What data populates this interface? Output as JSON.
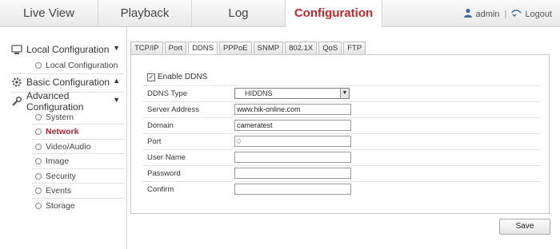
{
  "nav": {
    "tabs": [
      "Live View",
      "Playback",
      "Log",
      "Configuration"
    ],
    "active": "Configuration",
    "user": "admin",
    "logout": "Logout"
  },
  "sidebar": {
    "local": {
      "title": "Local Configuration",
      "items": [
        "Local Configuration"
      ]
    },
    "basic": {
      "title": "Basic Configuration"
    },
    "advanced": {
      "title": "Advanced Configuration",
      "items": [
        "System",
        "Network",
        "Video/Audio",
        "Image",
        "Security",
        "Events",
        "Storage"
      ]
    }
  },
  "tabs": [
    "TCP/IP",
    "Port",
    "DDNS",
    "PPPoE",
    "SNMP",
    "802.1X",
    "QoS",
    "FTP"
  ],
  "active_tab": "DDNS",
  "form": {
    "enable_label": "Enable DDNS",
    "enable_checked": true,
    "ddns_type_label": "DDNS Type",
    "ddns_type_value": "HIDDNS",
    "server_label": "Server Address",
    "server_value": "www.hik-online.com",
    "domain_label": "Domain",
    "domain_value": "cameratest",
    "port_label": "Port",
    "port_value": "0",
    "username_label": "User Name",
    "username_value": "",
    "password_label": "Password",
    "password_value": "",
    "confirm_label": "Confirm",
    "confirm_value": ""
  },
  "save_label": "Save",
  "icons": {
    "user": "user-icon",
    "logout": "logout-icon",
    "local": "local-config-icon",
    "basic": "gear-icon",
    "advanced": "wrench-icon"
  },
  "colors": {
    "accent": "#c0272d"
  }
}
